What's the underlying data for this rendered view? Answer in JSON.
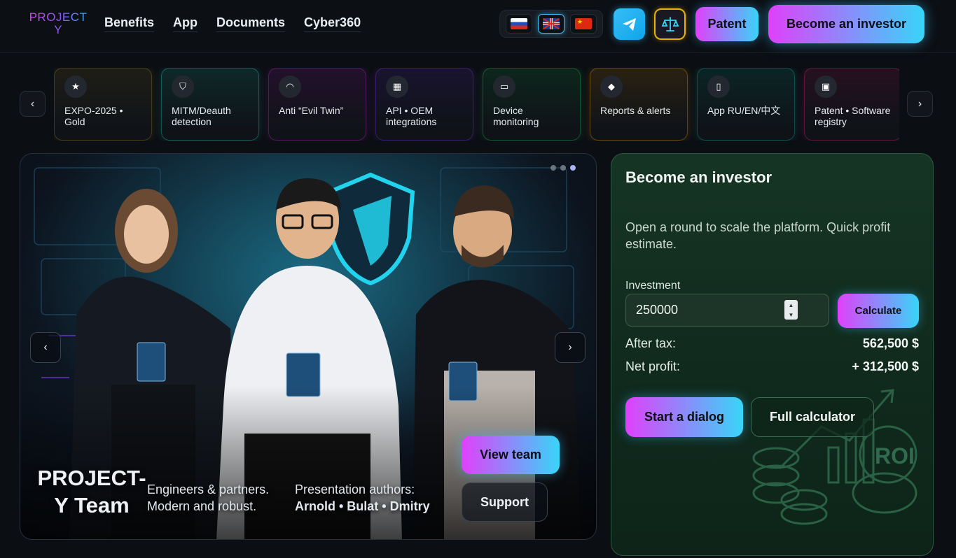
{
  "header": {
    "logo_line1": "PROJECT",
    "logo_line2": "Y",
    "nav": [
      "Benefits",
      "App",
      "Documents",
      "Cyber360"
    ],
    "languages": [
      "ru-flag-icon",
      "uk-flag-icon",
      "cn-flag-icon"
    ],
    "active_language": "uk-flag-icon",
    "telegram_icon": "telegram-icon",
    "law_icon": "scales-icon",
    "patent_label": "Patent",
    "investor_label": "Become an investor"
  },
  "features": {
    "prev": "‹",
    "next": "›",
    "items": [
      {
        "icon": "star-icon",
        "glyph": "★",
        "label": "EXPO-2025 • Gold",
        "color": "#a3852f"
      },
      {
        "icon": "shield-icon",
        "glyph": "⛉",
        "label": "MITM/Deauth detection",
        "color": "#2dd4bf"
      },
      {
        "icon": "wifi-icon",
        "glyph": "◠",
        "label": "Anti “Evil Twin”",
        "color": "#c026d3"
      },
      {
        "icon": "grid-icon",
        "glyph": "▦",
        "label": "API • OEM integrations",
        "color": "#7c3aed"
      },
      {
        "icon": "monitor-icon",
        "glyph": "▭",
        "label": "Device monitoring",
        "color": "#22c55e"
      },
      {
        "icon": "bell-icon",
        "glyph": "◆",
        "label": "Reports & alerts",
        "color": "#f59e0b"
      },
      {
        "icon": "phone-icon",
        "glyph": "▯",
        "label": "App RU/EN/中文",
        "color": "#14b8a6"
      },
      {
        "icon": "document-icon",
        "glyph": "▣",
        "label": "Patent • Software registry",
        "color": "#db2777"
      }
    ]
  },
  "hero": {
    "prev": "‹",
    "next": "›",
    "title": "PROJECT-Y Team",
    "subtitle_line1": "Engineers & partners.",
    "subtitle_line2": "Modern and robust.",
    "authors_label": "Presentation authors:",
    "authors": "Arnold • Bulat • Dmitry",
    "view_team": "View team",
    "support": "Support",
    "slide_count": 3,
    "active_slide": 3
  },
  "investor": {
    "title": "Become an investor",
    "description": "Open a round to scale the platform. Quick profit estimate.",
    "investment_label": "Investment",
    "investment_value": "250000",
    "calculate": "Calculate",
    "after_tax_label": "After tax:",
    "after_tax_value": "562,500 $",
    "net_profit_label": "Net profit:",
    "net_profit_value": "+ 312,500 $",
    "start_dialog": "Start a dialog",
    "full_calculator": "Full calculator",
    "roi_text": "ROI",
    "roi_icon": "roi-coins-icon"
  },
  "colors": {
    "accent_gradient_start": "#e040fb",
    "accent_gradient_end": "#38d5f8",
    "panel_green": "#163524",
    "background": "#0b0e13"
  }
}
